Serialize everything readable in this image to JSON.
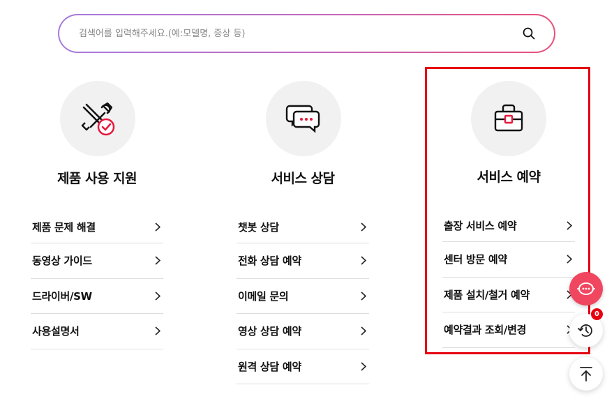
{
  "search": {
    "placeholder": "검색어를 입력해주세요.(예:모델명, 증상 등)"
  },
  "columns": [
    {
      "title": "제품 사용 지원",
      "icon": "tools-check-icon",
      "items": [
        "제품 문제 해결",
        "동영상 가이드",
        "드라이버/SW",
        "사용설명서"
      ]
    },
    {
      "title": "서비스 상담",
      "icon": "chat-bubbles-icon",
      "items": [
        "챗봇 상담",
        "전화 상담 예약",
        "이메일 문의",
        "영상 상담 예약",
        "원격 상담 예약"
      ]
    },
    {
      "title": "서비스 예약",
      "icon": "toolbox-icon",
      "items": [
        "출장 서비스 예약",
        "센터 방문 예약",
        "제품 설치/철거 예약",
        "예약결과 조회/변경"
      ]
    }
  ],
  "floating": {
    "recent_count": "0"
  },
  "colors": {
    "accent": "#e60012",
    "chat_button": "#f04660",
    "gradient_start": "#a77bdc",
    "gradient_end": "#e84f7a"
  }
}
